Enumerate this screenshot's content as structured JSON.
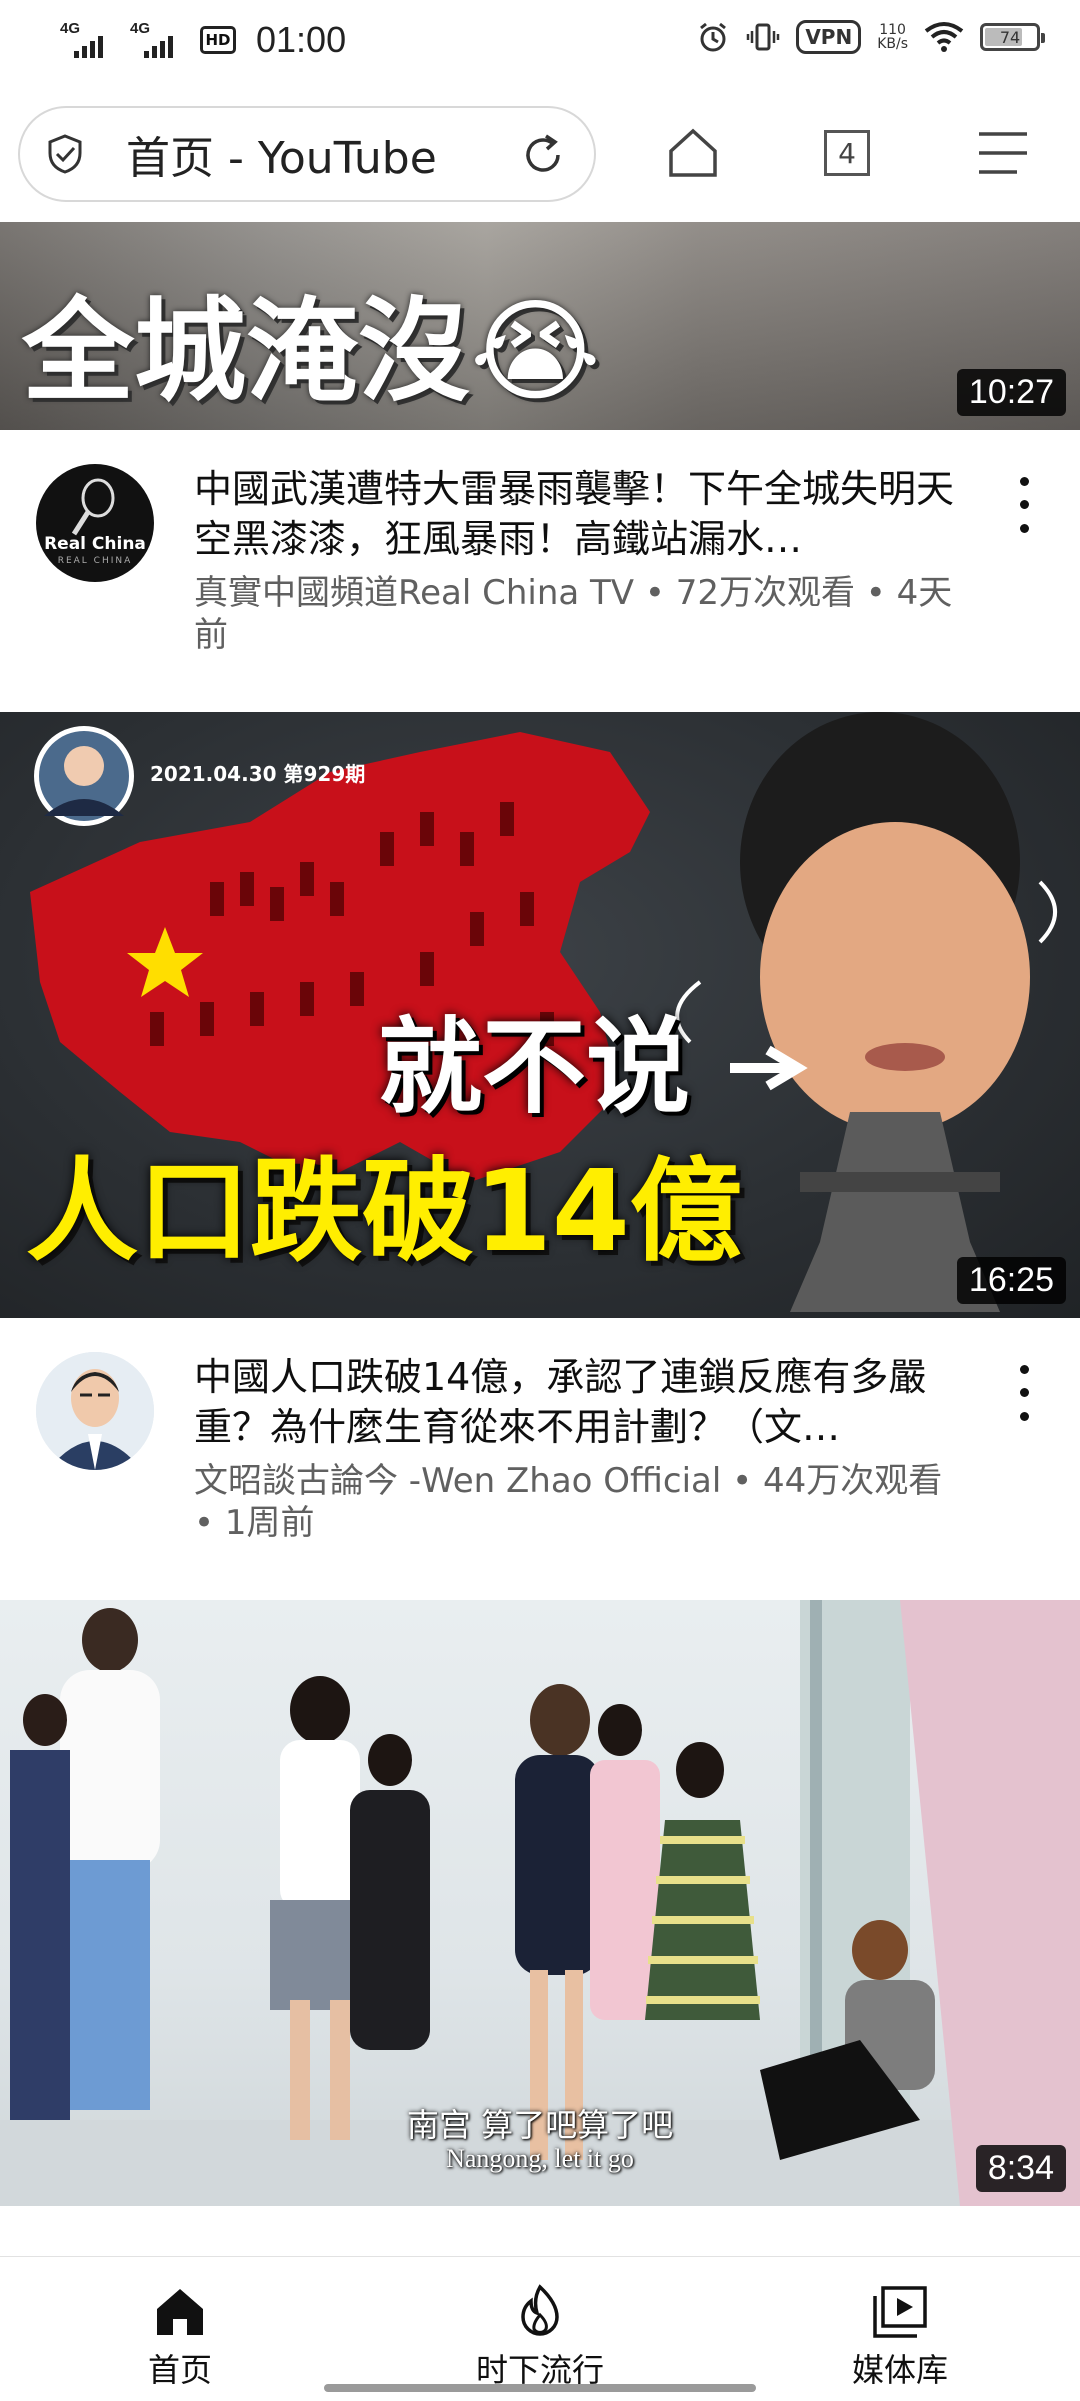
{
  "status_bar": {
    "net1": "4G",
    "net2": "4G",
    "hd": "HD",
    "time": "01:00",
    "vpn": "VPN",
    "speed_value": "110",
    "speed_unit": "KB/s",
    "battery": "74",
    "battery_level_percent": 74
  },
  "toolbar": {
    "page_title": "首页 - YouTube",
    "tab_count": "4"
  },
  "videos": [
    {
      "thumb_text": "全城淹沒😭",
      "duration": "10:27",
      "channel_avatar_text": "Real China",
      "channel_avatar_sub": "REAL CHINA",
      "title": "中國武漢遭特大雷暴雨襲擊！下午全城失明天空黑漆漆，狂風暴雨！高鐵站漏水…",
      "meta": "真實中國頻道Real China TV • 72万次观看 • 4天前"
    },
    {
      "thumb_date": "2021.04.30 第929期",
      "thumb_text_1": "就不说",
      "thumb_text_2": "人口跌破14億",
      "duration": "16:25",
      "title": "中國人口跌破14億，承認了連鎖反應有多嚴重？為什麼生育從來不用計劃？（文…",
      "meta": "文昭談古論今 -Wen Zhao Official • 44万次观看 • 1周前"
    },
    {
      "subtitle_cn": "南宫 算了吧算了吧",
      "subtitle_en": "Nangong, let it go",
      "duration": "8:34"
    }
  ],
  "bottom_nav": {
    "home": "首页",
    "trending": "时下流行",
    "library": "媒体库"
  },
  "colors": {
    "accent_red": "#e00000",
    "text_primary": "#0f0f0f",
    "text_secondary": "#606060"
  }
}
